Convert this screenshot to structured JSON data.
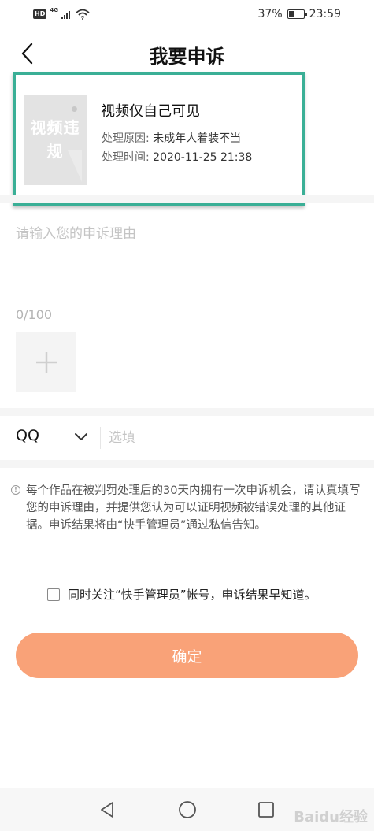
{
  "status_bar": {
    "hd": "HD",
    "network": "4G",
    "battery_percent": "37%",
    "battery_level": 0.37,
    "time": "23:59",
    "icons": [
      "signal-icon",
      "wifi-icon",
      "battery-icon"
    ]
  },
  "header": {
    "title": "我要申诉",
    "back_icon": "chevron-left-icon"
  },
  "video_card": {
    "thumbnail_text": "视频违规",
    "title": "视频仅自己可见",
    "reason_label": "处理原因:",
    "reason_value": "未成年人着装不当",
    "time_label": "处理时间:",
    "time_value": "2020-11-25 21:38",
    "highlight_color": "#3aaf96"
  },
  "appeal": {
    "placeholder": "请输入您的申诉理由",
    "counter": "0/100",
    "add_icon": "plus-icon"
  },
  "contact": {
    "type": "QQ",
    "placeholder": "选填",
    "dropdown_icon": "chevron-down-icon"
  },
  "notice": {
    "icon": "info-icon",
    "text": "每个作品在被判罚处理后的30天内拥有一次申诉机会，请认真填写您的申诉理由，并提供您认为可以证明视频被错误处理的其他证据。申诉结果将由“快手管理员”通过私信告知。"
  },
  "follow": {
    "checked": false,
    "text": "同时关注“快手管理员”帐号，申诉结果早知道。"
  },
  "confirm_button": {
    "label": "确定",
    "color": "#f9a278"
  },
  "system_nav": {
    "icons": [
      "back-triangle-icon",
      "home-circle-icon",
      "recents-square-icon"
    ]
  },
  "watermark": "Baidu经验"
}
